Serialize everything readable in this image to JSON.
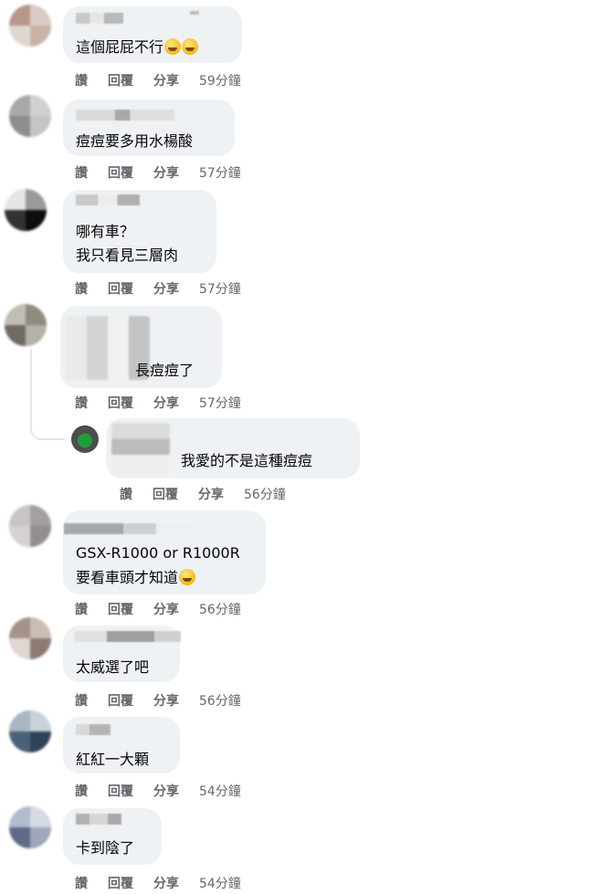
{
  "comments": [
    {
      "text_lines": [
        "這個屁屁不行"
      ],
      "emojis": [
        "crying-face-emoji",
        "crying-face-emoji"
      ],
      "actions": {
        "like": "讚",
        "reply": "回覆",
        "share": "分享",
        "time": "59分鐘"
      }
    },
    {
      "text_lines": [
        "痘痘要多用水楊酸"
      ],
      "actions": {
        "like": "讚",
        "reply": "回覆",
        "share": "分享",
        "time": "57分鐘"
      }
    },
    {
      "text_lines": [
        "哪有車？",
        "我只看見三層肉"
      ],
      "actions": {
        "like": "讚",
        "reply": "回覆",
        "share": "分享",
        "time": "57分鐘"
      }
    },
    {
      "text_lines": [
        "長痘痘了"
      ],
      "actions": {
        "like": "讚",
        "reply": "回覆",
        "share": "分享",
        "time": "57分鐘"
      },
      "reply": {
        "text_lines": [
          "我愛的不是這種痘痘"
        ],
        "actions": {
          "like": "讚",
          "reply": "回覆",
          "share": "分享",
          "time": "56分鐘"
        }
      }
    },
    {
      "text_lines": [
        "GSX-R1000 or R1000R",
        "要看車頭才知道"
      ],
      "emojis": [
        "laughing-crying-emoji"
      ],
      "actions": {
        "like": "讚",
        "reply": "回覆",
        "share": "分享",
        "time": "56分鐘"
      }
    },
    {
      "text_lines": [
        "太威選了吧"
      ],
      "actions": {
        "like": "讚",
        "reply": "回覆",
        "share": "分享",
        "time": "56分鐘"
      }
    },
    {
      "text_lines": [
        "紅紅一大顆"
      ],
      "actions": {
        "like": "讚",
        "reply": "回覆",
        "share": "分享",
        "time": "54分鐘"
      }
    },
    {
      "text_lines": [
        "卡到陰了"
      ],
      "actions": {
        "like": "讚",
        "reply": "回覆",
        "share": "分享",
        "time": "54分鐘"
      }
    }
  ],
  "colors": {
    "bubble": "#eff2f5",
    "action_text": "#65676b",
    "comment_text": "#050505"
  }
}
